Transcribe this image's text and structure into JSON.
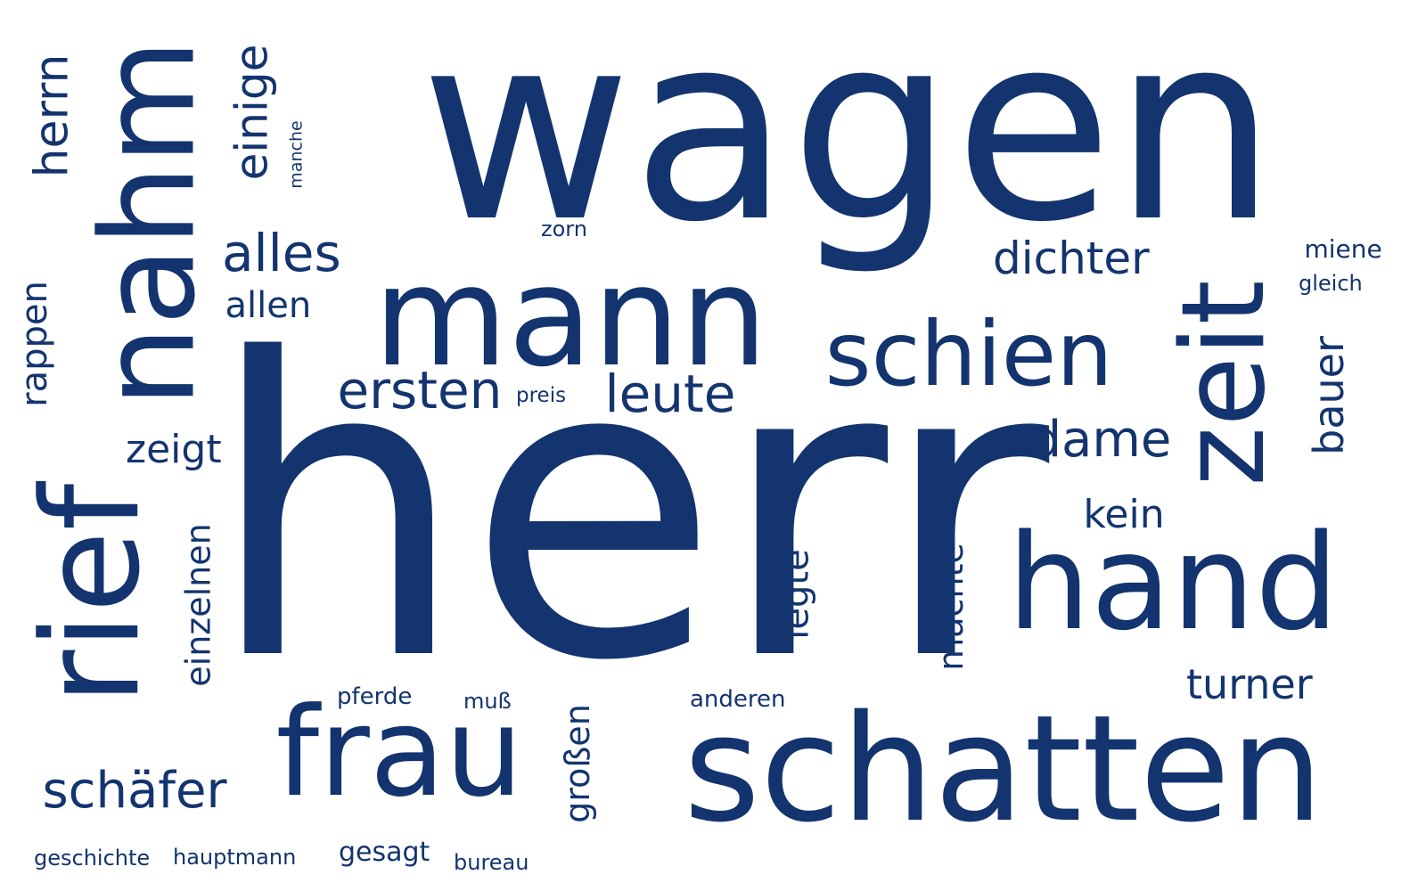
{
  "word_cloud": {
    "color": "#13346e",
    "background": "#ffffff",
    "words": [
      {
        "text": "wagen"
      },
      {
        "text": "herr"
      },
      {
        "text": "mann"
      },
      {
        "text": "schatten"
      },
      {
        "text": "frau"
      },
      {
        "text": "hand"
      },
      {
        "text": "rief"
      },
      {
        "text": "nahm"
      },
      {
        "text": "zeit"
      },
      {
        "text": "schien"
      },
      {
        "text": "alles"
      },
      {
        "text": "ersten"
      },
      {
        "text": "leute"
      },
      {
        "text": "dichter"
      },
      {
        "text": "dame"
      },
      {
        "text": "herrn"
      },
      {
        "text": "einige"
      },
      {
        "text": "schäfer"
      },
      {
        "text": "bauer"
      },
      {
        "text": "turner"
      },
      {
        "text": "zeigt"
      },
      {
        "text": "kein"
      },
      {
        "text": "allen"
      },
      {
        "text": "rappen"
      },
      {
        "text": "einzelnen"
      },
      {
        "text": "legte"
      },
      {
        "text": "machte"
      },
      {
        "text": "großen"
      },
      {
        "text": "gesagt"
      },
      {
        "text": "miene"
      },
      {
        "text": "pferde"
      },
      {
        "text": "anderen"
      },
      {
        "text": "hauptmann"
      },
      {
        "text": "geschichte"
      },
      {
        "text": "bureau"
      },
      {
        "text": "gleich"
      },
      {
        "text": "muß"
      },
      {
        "text": "zorn"
      },
      {
        "text": "preis"
      },
      {
        "text": "manche"
      }
    ]
  }
}
